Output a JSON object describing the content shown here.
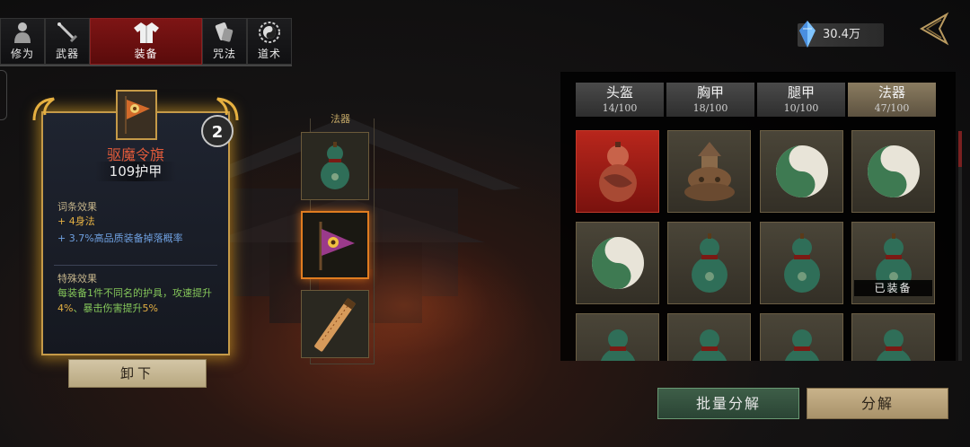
{
  "tabs": [
    {
      "label": "修为",
      "icon": "character-icon"
    },
    {
      "label": "武器",
      "icon": "sword-icon"
    },
    {
      "label": "装备",
      "icon": "robe-icon",
      "active": true
    },
    {
      "label": "咒法",
      "icon": "scroll-icon"
    },
    {
      "label": "道术",
      "icon": "yin-yang-icon"
    }
  ],
  "currency": {
    "amount": "30.4万",
    "icon": "crystal-icon"
  },
  "item": {
    "name": "驱魔令旗",
    "stat": "109护甲",
    "level": "2",
    "affix_title": "词条效果",
    "affix_1": "+ 4身法",
    "affix_2_value": "+ 3.7%",
    "affix_2_text": "高品质装备掉落概率",
    "special_title": "特殊效果",
    "special_a": "每装备1件不同名的护具，攻速提升",
    "special_b": "4%",
    "special_c": "、暴击伤害提升",
    "special_d": "5%",
    "unequip": "卸下"
  },
  "slots": {
    "label": "法器",
    "items": [
      {
        "icon": "gourd-icon"
      },
      {
        "icon": "flag-icon",
        "selected": true
      },
      {
        "icon": "talisman-scroll-icon"
      }
    ]
  },
  "categories": [
    {
      "name": "头盔",
      "count": "14/100"
    },
    {
      "name": "胸甲",
      "count": "18/100"
    },
    {
      "name": "腿甲",
      "count": "10/100"
    },
    {
      "name": "法器",
      "count": "47/100",
      "active": true
    }
  ],
  "inventory": [
    {
      "icon": "red-gourd-icon",
      "rarity": "red"
    },
    {
      "icon": "bronze-censer-icon"
    },
    {
      "icon": "yin-yang-disc-icon"
    },
    {
      "icon": "yin-yang-disc-icon"
    },
    {
      "icon": "yin-yang-disc-icon"
    },
    {
      "icon": "gourd-icon"
    },
    {
      "icon": "gourd-icon"
    },
    {
      "icon": "gourd-icon",
      "equipped": "已装备"
    },
    {
      "icon": "gourd-icon"
    },
    {
      "icon": "gourd-icon"
    },
    {
      "icon": "gourd-icon"
    },
    {
      "icon": "gourd-icon"
    }
  ],
  "actions": {
    "batch": "批量分解",
    "salvage": "分解"
  },
  "colors": {
    "accent_red": "#7e1515",
    "gold_border": "#c59a48",
    "affix_gold": "#e4b043",
    "affix_blue": "#6fa0e0",
    "special_green": "#84c65a",
    "item_name": "#e05a3a"
  }
}
